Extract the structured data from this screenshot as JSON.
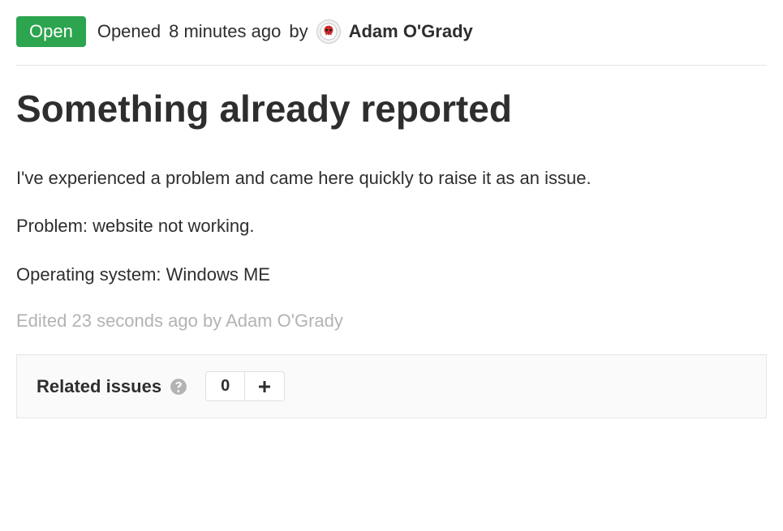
{
  "status": {
    "label": "Open",
    "color": "#2da44e"
  },
  "meta": {
    "opened_prefix": "Opened ",
    "opened_time": "8 minutes ago",
    "by_text": " by ",
    "author_name": "Adam O'Grady"
  },
  "issue": {
    "title": "Something already reported",
    "body_paragraphs": [
      "I've experienced a problem and came here quickly to raise it as an issue.",
      "Problem: website not working.",
      "Operating system: Windows ME"
    ],
    "edited_note": "Edited 23 seconds ago by Adam O'Grady"
  },
  "related": {
    "label": "Related issues",
    "count": "0",
    "add_label": "+"
  }
}
